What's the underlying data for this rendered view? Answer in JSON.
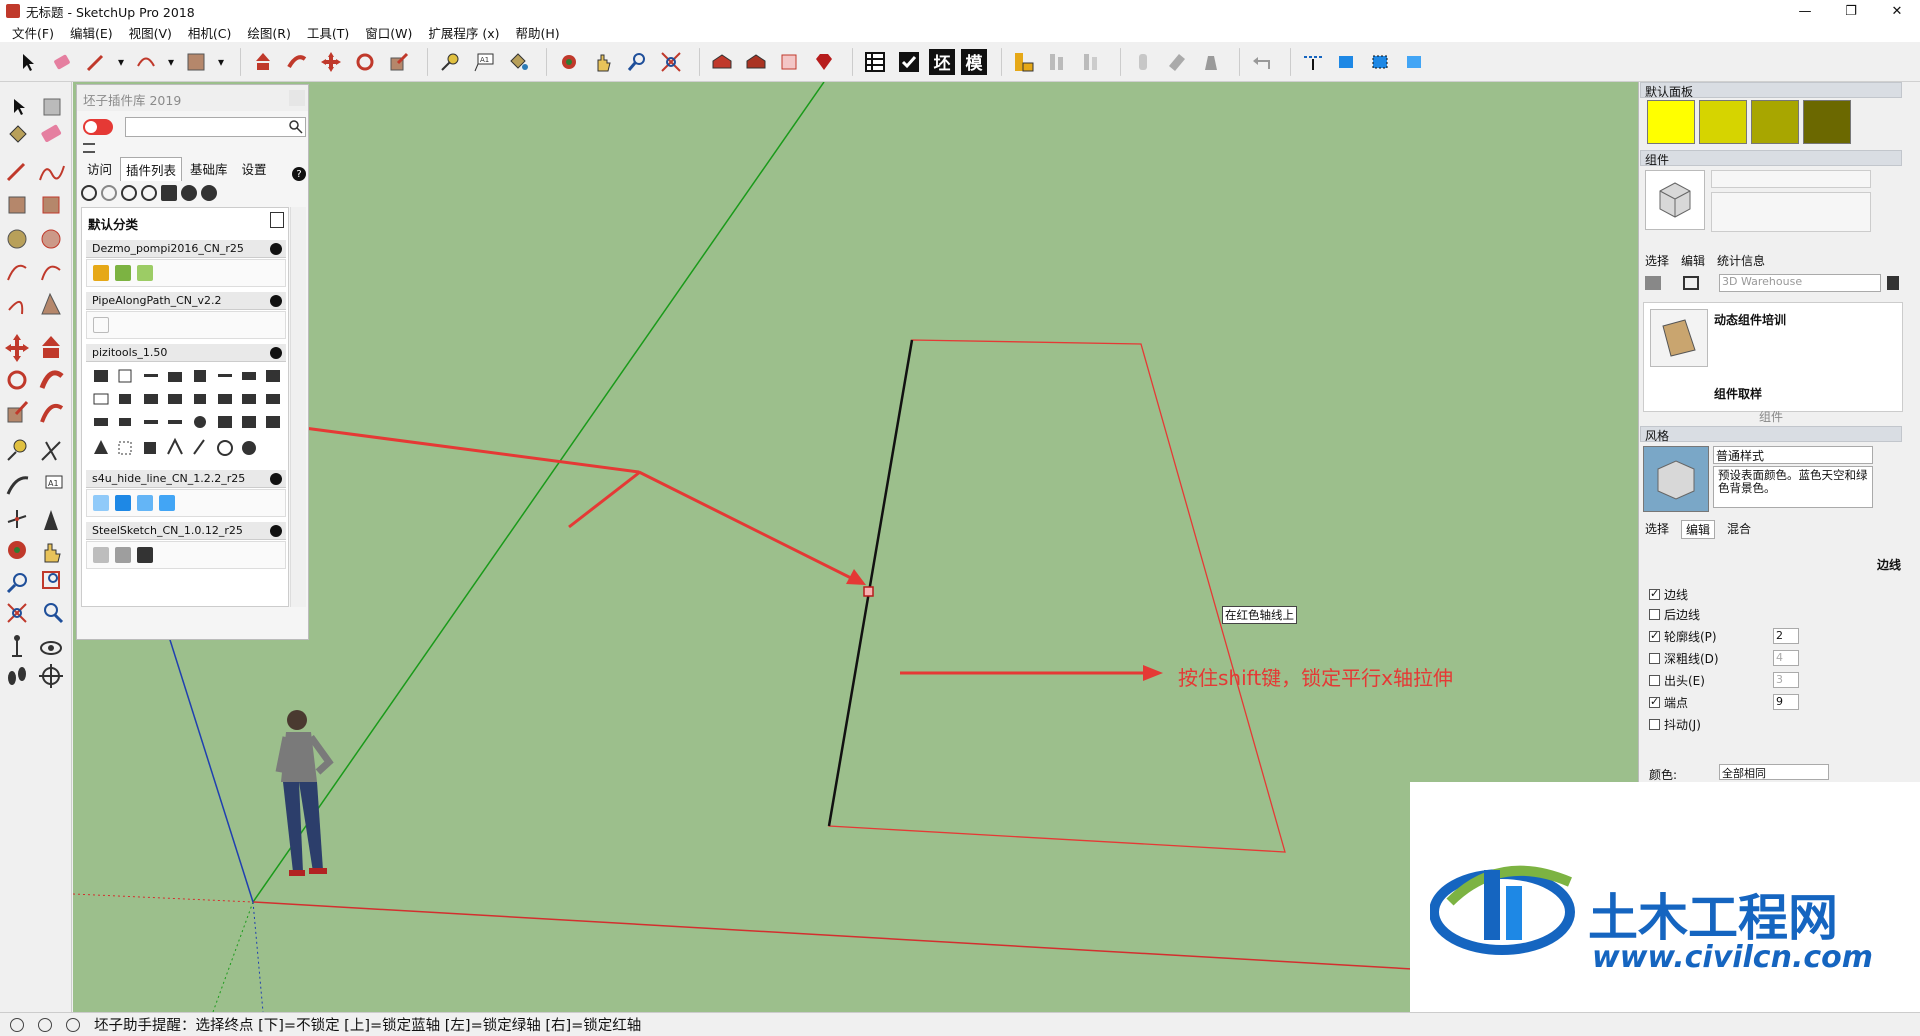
{
  "window": {
    "title": "无标题 - SketchUp Pro 2018"
  },
  "menu": [
    "文件(F)",
    "编辑(E)",
    "视图(V)",
    "相机(C)",
    "绘图(R)",
    "工具(T)",
    "窗口(W)",
    "扩展程序 (x)",
    "帮助(H)"
  ],
  "toolbar": {
    "text_buttons": [
      "坯",
      "模"
    ]
  },
  "plugin_panel": {
    "title": "坯子插件库 2019",
    "tabs": [
      "访问",
      "插件列表",
      "基础库",
      "设置"
    ],
    "active_tab": "插件列表",
    "help": "?",
    "category": "默认分类",
    "plugins": [
      "Dezmo_pompi2016_CN_r25",
      "PipeAlongPath_CN_v2.2",
      "pizitools_1.50",
      "s4u_hide_line_CN_1.2.2_r25",
      "SteelSketch_CN_1.0.12_r25"
    ]
  },
  "right_panel": {
    "default_tray": "默认面板",
    "swatch_colors": [
      "#ffff00",
      "#d6d400",
      "#a8a600",
      "#6b6800"
    ],
    "components_header": "组件",
    "comp_tabs": [
      "选择",
      "编辑",
      "统计信息"
    ],
    "search_placeholder": "3D Warehouse",
    "items": [
      "动态组件培训",
      "组件取样"
    ],
    "components_footer": "组件",
    "styles_header": "风格",
    "style_name": "普通样式",
    "style_desc": "预设表面颜色。蓝色天空和绿色背景色。",
    "style_tabs": [
      "选择",
      "编辑",
      "混合"
    ],
    "edge_label": "边线",
    "settings": [
      {
        "label": "边线",
        "checked": true,
        "value": ""
      },
      {
        "label": "后边线",
        "checked": false,
        "value": ""
      },
      {
        "label": "轮廓线(P)",
        "checked": true,
        "value": "2"
      },
      {
        "label": "深粗线(D)",
        "checked": false,
        "value": "4"
      },
      {
        "label": "出头(E)",
        "checked": false,
        "value": "3"
      },
      {
        "label": "端点",
        "checked": true,
        "value": "9"
      },
      {
        "label": "抖动(J)",
        "checked": false,
        "value": ""
      }
    ],
    "color_label": "颜色:",
    "color_value": "全部相同"
  },
  "viewport": {
    "tooltip": "在红色轴线上",
    "annotation": "按住shift键，锁定平行x轴拉伸",
    "bg_color": "#9cbf8c"
  },
  "status": {
    "message": "坯子助手提醒：选择终点 [下]=不锁定 [上]=锁定蓝轴 [左]=锁定绿轴 [右]=锁定红轴"
  },
  "watermark": {
    "title": "土木工程网",
    "url": "www.civilcn.com"
  }
}
